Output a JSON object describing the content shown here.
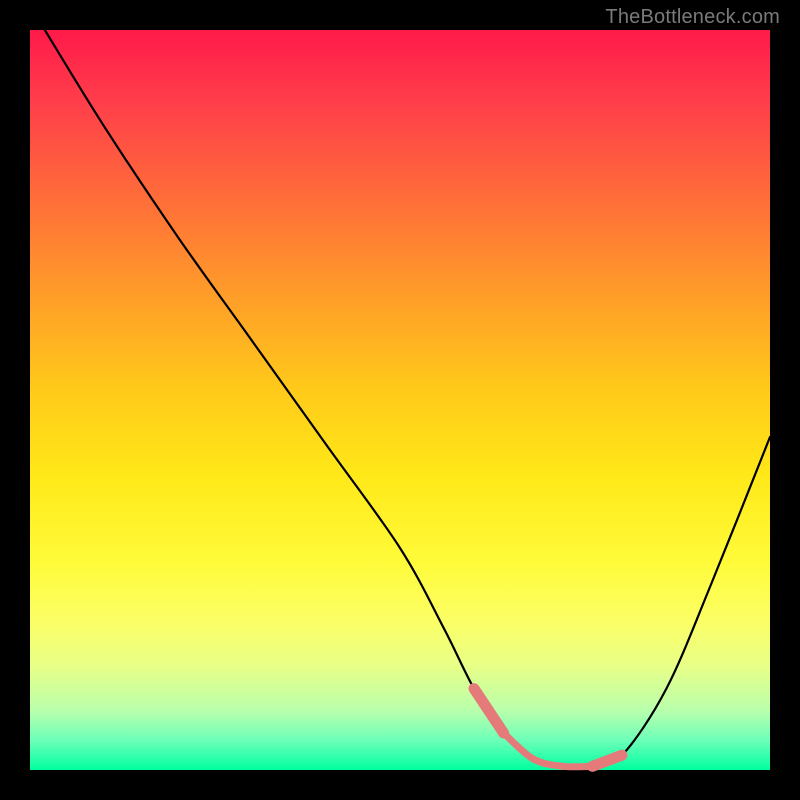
{
  "watermark": "TheBottleneck.com",
  "chart_data": {
    "type": "line",
    "title": "",
    "xlabel": "",
    "ylabel": "",
    "xlim": [
      0,
      100
    ],
    "ylim": [
      0,
      100
    ],
    "series": [
      {
        "name": "bottleneck-curve",
        "x": [
          2,
          10,
          20,
          30,
          40,
          50,
          56,
          60,
          64,
          68,
          72,
          76,
          80,
          86,
          92,
          100
        ],
        "values": [
          100,
          87,
          72,
          58,
          44,
          30,
          19,
          11,
          5,
          1.5,
          0.5,
          0.5,
          2,
          11,
          25,
          45
        ]
      }
    ],
    "highlight_band": {
      "x_start": 60,
      "x_end": 80,
      "color": "#e47a7a"
    },
    "gradient_stops": [
      {
        "pos": 0,
        "color": "#ff1a4a"
      },
      {
        "pos": 50,
        "color": "#ffe818"
      },
      {
        "pos": 100,
        "color": "#00ffa0"
      }
    ]
  }
}
